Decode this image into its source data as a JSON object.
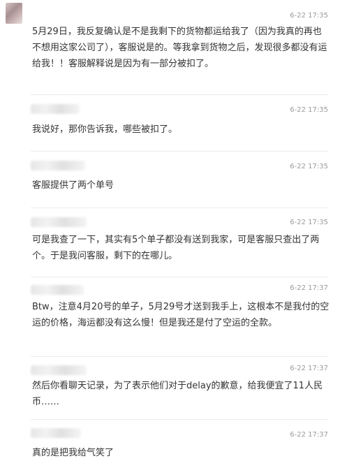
{
  "comments": [
    {
      "time": "6-22 17:35",
      "text": "5月29日，我反复确认是不是我剩下的货物都运给我了（因为我真的再也不想用这家公司了），客服说是的。等我拿到货物之后，发现很多都没有运给我！！客服解释说是因为有一部分被扣了。"
    },
    {
      "time": "6-22 17:35",
      "text": "我说好，那你告诉我，哪些被扣了。"
    },
    {
      "time": "6-22 17:35",
      "text": "客服提供了两个单号"
    },
    {
      "time": "6-22 17:35",
      "text": "可是我查了一下，其实有5个单子都没有送到我家，可是客服只查出了两个。于是我问客服，剩下的在哪儿。"
    },
    {
      "time": "6-22 17:37",
      "text": "Btw，注意4月20号的单子，5月29号才送到我手上，这根本不是我付的空运的价格，海运都没有这么慢！但是我还是付了空运的全款。"
    },
    {
      "time": "6-22 17:37",
      "text": "然后你看聊天记录，为了表示他们对于delay的歉意，给我便宜了11人民币……"
    },
    {
      "time": "6-22 17:37",
      "text": "真的是把我给气笑了"
    }
  ]
}
